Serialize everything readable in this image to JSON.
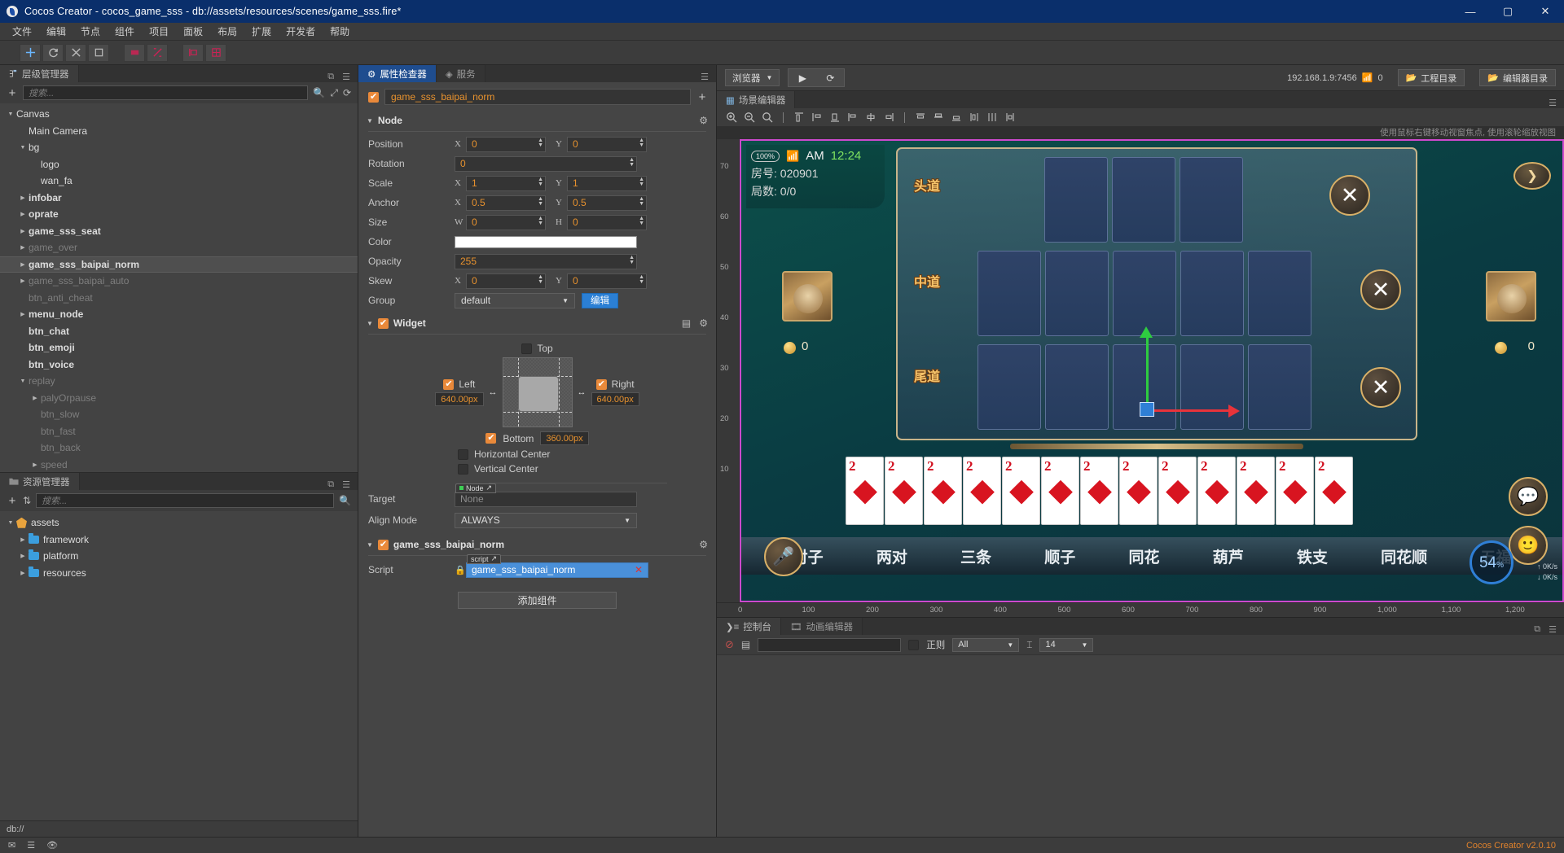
{
  "titlebar": {
    "title": "Cocos Creator - cocos_game_sss - db://assets/resources/scenes/game_sss.fire*",
    "minimize": "—",
    "maximize": "▢",
    "close": "✕"
  },
  "menubar": {
    "items": [
      "文件",
      "编辑",
      "节点",
      "组件",
      "项目",
      "面板",
      "布局",
      "扩展",
      "开发者",
      "帮助"
    ]
  },
  "hierarchy": {
    "tab": "层级管理器",
    "search_placeholder": "搜索...",
    "add_label": "+",
    "nodes": [
      {
        "label": "Canvas",
        "depth": 0,
        "arrow": "down",
        "dim": false,
        "selected": false
      },
      {
        "label": "Main Camera",
        "depth": 1,
        "arrow": "none",
        "dim": false,
        "selected": false
      },
      {
        "label": "bg",
        "depth": 1,
        "arrow": "down",
        "dim": false,
        "selected": false
      },
      {
        "label": "logo",
        "depth": 2,
        "arrow": "none",
        "dim": false,
        "selected": false
      },
      {
        "label": "wan_fa",
        "depth": 2,
        "arrow": "none",
        "dim": false,
        "selected": false
      },
      {
        "label": "infobar",
        "depth": 1,
        "arrow": "right",
        "dim": false,
        "selected": false
      },
      {
        "label": "oprate",
        "depth": 1,
        "arrow": "right",
        "dim": false,
        "selected": false
      },
      {
        "label": "game_sss_seat",
        "depth": 1,
        "arrow": "right",
        "dim": false,
        "selected": false
      },
      {
        "label": "game_over",
        "depth": 1,
        "arrow": "right",
        "dim": true,
        "selected": false
      },
      {
        "label": "game_sss_baipai_norm",
        "depth": 1,
        "arrow": "right",
        "dim": false,
        "selected": true
      },
      {
        "label": "game_sss_baipai_auto",
        "depth": 1,
        "arrow": "right",
        "dim": true,
        "selected": false
      },
      {
        "label": "btn_anti_cheat",
        "depth": 1,
        "arrow": "none",
        "dim": true,
        "selected": false
      },
      {
        "label": "menu_node",
        "depth": 1,
        "arrow": "right",
        "dim": false,
        "selected": false
      },
      {
        "label": "btn_chat",
        "depth": 1,
        "arrow": "none",
        "dim": false,
        "selected": false
      },
      {
        "label": "btn_emoji",
        "depth": 1,
        "arrow": "none",
        "dim": false,
        "selected": false
      },
      {
        "label": "btn_voice",
        "depth": 1,
        "arrow": "none",
        "dim": false,
        "selected": false
      },
      {
        "label": "replay",
        "depth": 1,
        "arrow": "down",
        "dim": true,
        "selected": false
      },
      {
        "label": "palyOrpause",
        "depth": 2,
        "arrow": "right",
        "dim": true,
        "selected": false
      },
      {
        "label": "btn_slow",
        "depth": 2,
        "arrow": "none",
        "dim": true,
        "selected": false
      },
      {
        "label": "btn_fast",
        "depth": 2,
        "arrow": "none",
        "dim": true,
        "selected": false
      },
      {
        "label": "btn_back",
        "depth": 2,
        "arrow": "none",
        "dim": true,
        "selected": false
      },
      {
        "label": "speed",
        "depth": 2,
        "arrow": "right",
        "dim": true,
        "selected": false
      }
    ]
  },
  "assets": {
    "tab": "资源管理器",
    "search_placeholder": "搜索...",
    "nodes": [
      {
        "label": "assets",
        "depth": 0,
        "arrow": "down",
        "icon": "assets-icon"
      },
      {
        "label": "framework",
        "depth": 1,
        "arrow": "right",
        "icon": "folder-icon"
      },
      {
        "label": "platform",
        "depth": 1,
        "arrow": "right",
        "icon": "folder-icon"
      },
      {
        "label": "resources",
        "depth": 1,
        "arrow": "right",
        "icon": "folder-icon"
      }
    ],
    "status_path": "db://"
  },
  "inspector": {
    "tab": "属性检查器",
    "tab2": "服务",
    "node_name": "game_sss_baipai_norm",
    "node_enabled": true,
    "add_component_plus": "+",
    "node_section": {
      "title": "Node",
      "position": {
        "label": "Position",
        "x_axis": "X",
        "y_axis": "Y",
        "x": "0",
        "y": "0"
      },
      "rotation": {
        "label": "Rotation",
        "value": "0"
      },
      "scale": {
        "label": "Scale",
        "x_axis": "X",
        "y_axis": "Y",
        "x": "1",
        "y": "1"
      },
      "anchor": {
        "label": "Anchor",
        "x_axis": "X",
        "y_axis": "Y",
        "x": "0.5",
        "y": "0.5"
      },
      "size": {
        "label": "Size",
        "w_axis": "W",
        "h_axis": "H",
        "w": "0",
        "h": "0"
      },
      "color": {
        "label": "Color",
        "value": "#FFFFFF"
      },
      "opacity": {
        "label": "Opacity",
        "value": "255"
      },
      "skew": {
        "label": "Skew",
        "x_axis": "X",
        "y_axis": "Y",
        "x": "0",
        "y": "0"
      },
      "group": {
        "label": "Group",
        "value": "default",
        "edit_button": "编辑"
      }
    },
    "widget_section": {
      "title": "Widget",
      "enabled": true,
      "top": {
        "label": "Top",
        "checked": false
      },
      "left": {
        "label": "Left",
        "checked": true,
        "value": "640.00px"
      },
      "right": {
        "label": "Right",
        "checked": true,
        "value": "640.00px"
      },
      "bottom": {
        "label": "Bottom",
        "checked": true,
        "value": "360.00px"
      },
      "horizontal_center": {
        "label": "Horizontal Center",
        "checked": false
      },
      "vertical_center": {
        "label": "Vertical Center",
        "checked": false
      },
      "target": {
        "label": "Target",
        "chip": "Node",
        "value": "None"
      },
      "align_mode": {
        "label": "Align Mode",
        "value": "ALWAYS"
      }
    },
    "script_section": {
      "title": "game_sss_baipai_norm",
      "enabled": true,
      "script": {
        "label": "Script",
        "chip": "script",
        "value": "game_sss_baipai_norm",
        "clear": "✕"
      }
    },
    "add_component_button": "添加组件"
  },
  "playbar": {
    "browser": "浏览器",
    "play": "▶",
    "refresh": "⟳",
    "ip": "192.168.1.9:7456",
    "device_count": "0",
    "project_dir": "工程目录",
    "editor_dir": "编辑器目录"
  },
  "scene": {
    "tab": "场景编辑器",
    "hint": "使用鼠标右键移动视窗焦点, 使用滚轮缩放视图",
    "ruler_v": [
      "70",
      "60",
      "50",
      "40",
      "30",
      "20",
      "10"
    ],
    "ruler_h": [
      "0",
      "100",
      "200",
      "300",
      "400",
      "500",
      "600",
      "700",
      "800",
      "900",
      "1,000",
      "1,100",
      "1,200"
    ],
    "game": {
      "zoom_badge": "100%",
      "clock_ampm": "AM",
      "clock_time": "12:24",
      "room_label": "房号: 020901",
      "round_label": "局数: 0/0",
      "lanes": [
        "头道",
        "中道",
        "尾道"
      ],
      "coin_left": "0",
      "coin_right": "0",
      "hand_types": [
        "对子",
        "两对",
        "三条",
        "顺子",
        "同花",
        "葫芦",
        "铁支",
        "同花顺",
        "五福"
      ],
      "card_rank": "2",
      "card_count": 13,
      "x_marks": [
        "✕",
        "✕",
        "✕"
      ],
      "fps": "54",
      "fps_unit": "%",
      "net_up": "0K/s",
      "net_down": "0K/s"
    }
  },
  "console": {
    "tab": "控制台",
    "tab2": "动画编辑器",
    "clear_icon": "⊘",
    "file_icon": "▤",
    "filter_value": "",
    "regex_label": "正则",
    "regex_checked": false,
    "level_filter": "All",
    "font_size": "14"
  },
  "statusbar": {
    "version": "Cocos Creator v2.0.10"
  },
  "colors": {
    "accent_orange": "#e8922e",
    "accent_blue": "#2b7fd4",
    "selection_blue": "#4a90d9",
    "canvas_border": "#cd49cd"
  }
}
